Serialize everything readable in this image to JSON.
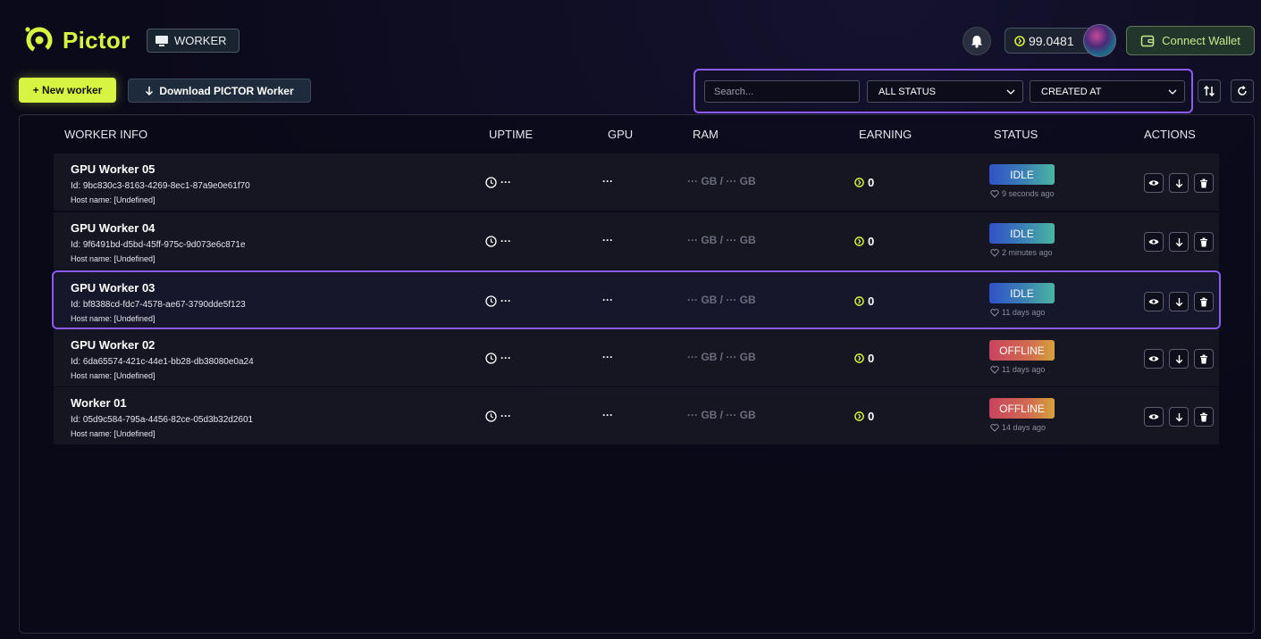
{
  "app": {
    "name": "Pictor",
    "section_badge": "WORKER"
  },
  "header": {
    "balance": "99.0481",
    "connect_wallet": "Connect Wallet"
  },
  "toolbar": {
    "new_worker": "+ New worker",
    "download": "Download PICTOR Worker",
    "search_placeholder": "Search...",
    "status_filter": "ALL STATUS",
    "sort_filter": "CREATED AT"
  },
  "table": {
    "columns": {
      "worker_info": "WORKER INFO",
      "uptime": "UPTIME",
      "gpu": "GPU",
      "ram": "RAM",
      "earning": "EARNING",
      "status": "STATUS",
      "actions": "ACTIONS"
    },
    "rows": [
      {
        "name": "GPU Worker 05",
        "id": "Id: 9bc830c3-8163-4269-8ec1-87a9e0e61f70",
        "host": "Host name: [Undefined]",
        "uptime": "···",
        "gpu": "···",
        "ram": "··· GB / ··· GB",
        "earning": "0",
        "status": "IDLE",
        "status_time": "9 seconds ago"
      },
      {
        "name": "GPU Worker 04",
        "id": "Id: 9f6491bd-d5bd-45ff-975c-9d073e6c871e",
        "host": "Host name: [Undefined]",
        "uptime": "···",
        "gpu": "···",
        "ram": "··· GB / ··· GB",
        "earning": "0",
        "status": "IDLE",
        "status_time": "2 minutes ago"
      },
      {
        "name": "GPU Worker 03",
        "id": "Id: bf8388cd-fdc7-4578-ae67-3790dde5f123",
        "host": "Host name: [Undefined]",
        "uptime": "···",
        "gpu": "···",
        "ram": "··· GB / ··· GB",
        "earning": "0",
        "status": "IDLE",
        "status_time": "11 days ago"
      },
      {
        "name": "GPU Worker 02",
        "id": "Id: 6da65574-421c-44e1-bb28-db38080e0a24",
        "host": "Host name: [Undefined]",
        "uptime": "···",
        "gpu": "···",
        "ram": "··· GB / ··· GB",
        "earning": "0",
        "status": "OFFLINE",
        "status_time": "11 days ago"
      },
      {
        "name": "Worker 01",
        "id": "Id: 05d9c584-795a-4456-82ce-05d3b32d2601",
        "host": "Host name: [Undefined]",
        "uptime": "···",
        "gpu": "···",
        "ram": "··· GB / ··· GB",
        "earning": "0",
        "status": "OFFLINE",
        "status_time": "14 days ago"
      }
    ]
  },
  "colors": {
    "accent": "#d8f442",
    "highlight": "#8a5cf0",
    "idle": "#3c82b3",
    "offline": "#c9445e"
  },
  "icons": {
    "bell": "bell-icon",
    "coin": "coin-icon",
    "wallet": "wallet-icon",
    "monitor": "monitor-icon",
    "download": "arrow-down-icon",
    "chevron": "chevron-down-icon",
    "sort": "sort-icon",
    "refresh": "refresh-icon",
    "clock": "clock-icon",
    "heart": "heart-icon",
    "eye": "eye-icon",
    "trash": "trash-icon"
  }
}
